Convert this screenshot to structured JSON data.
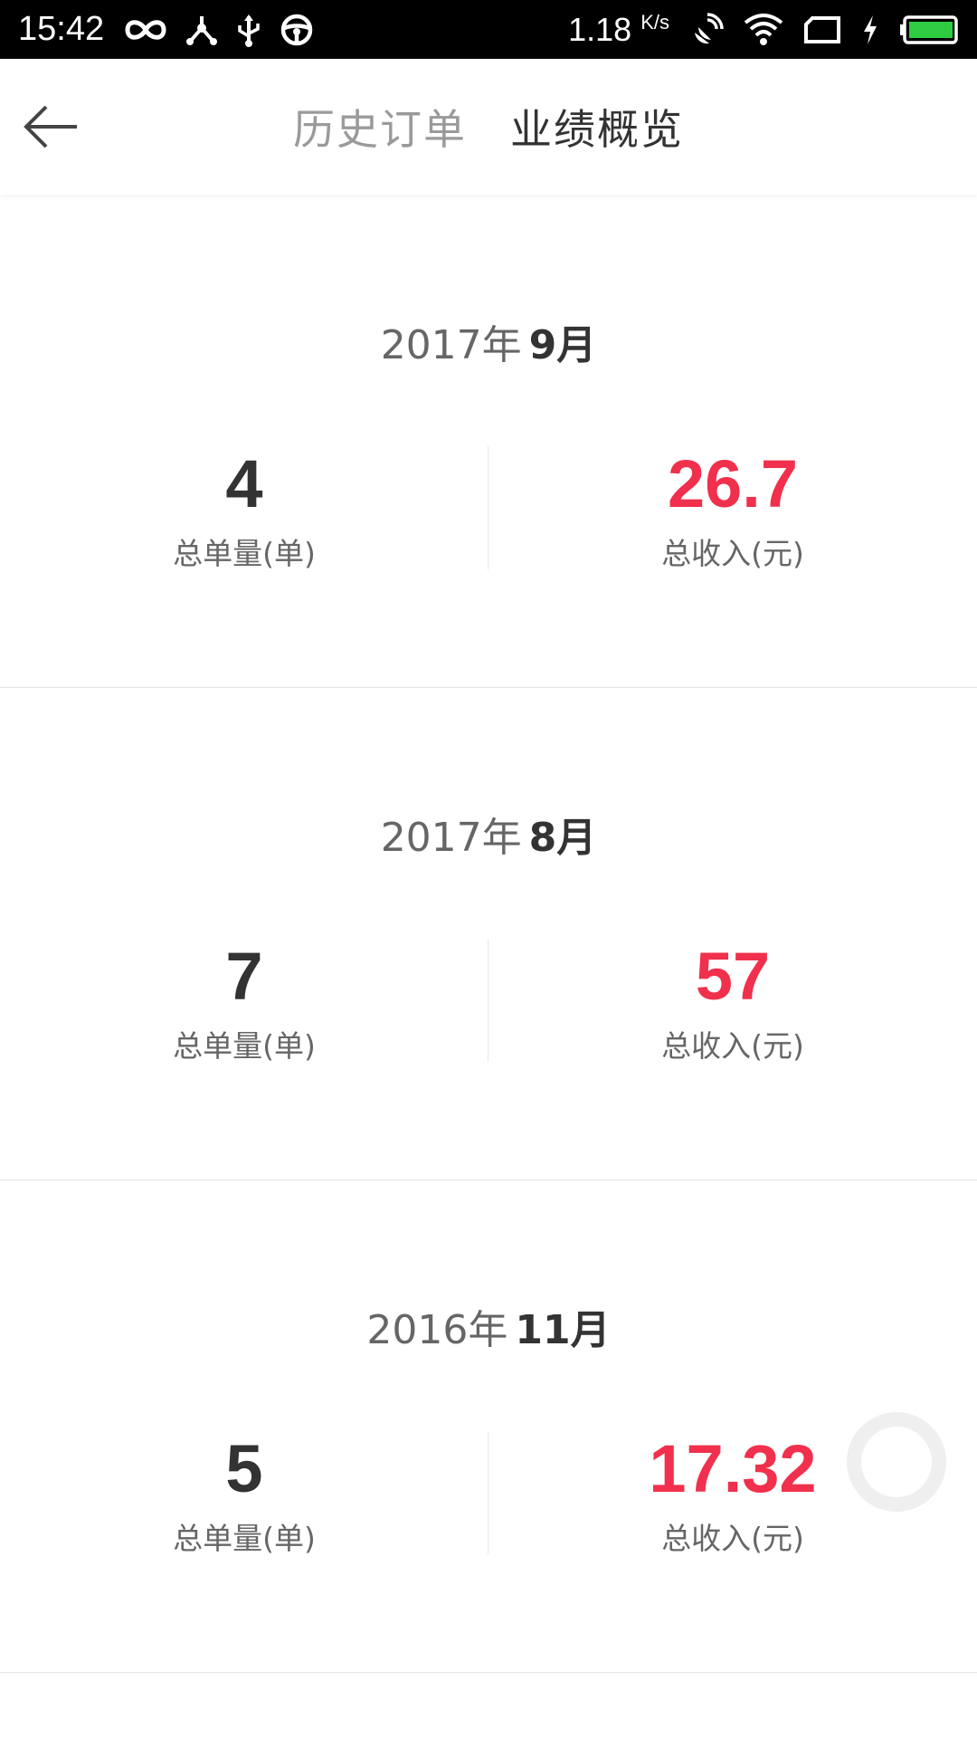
{
  "status_bar": {
    "time": "15:42",
    "net_speed": "1.18",
    "net_speed_unit": "K/s",
    "battery_color": "#2ecc40"
  },
  "header": {
    "back_icon": "arrow-left-icon",
    "tabs": [
      {
        "label": "历史订单",
        "active": false
      },
      {
        "label": "业绩概览",
        "active": true
      }
    ]
  },
  "sections": [
    {
      "year": "2017年",
      "month": "9月",
      "orders_value": "4",
      "orders_label": "总单量(单)",
      "income_value": "26.7",
      "income_label": "总收入(元)"
    },
    {
      "year": "2017年",
      "month": "8月",
      "orders_value": "7",
      "orders_label": "总单量(单)",
      "income_value": "57",
      "income_label": "总收入(元)"
    },
    {
      "year": "2016年",
      "month": "11月",
      "orders_value": "5",
      "orders_label": "总单量(单)",
      "income_value": "17.32",
      "income_label": "总收入(元)"
    }
  ],
  "colors": {
    "income": "#f0304c",
    "primary_text": "#333333",
    "secondary_text": "#666666"
  }
}
